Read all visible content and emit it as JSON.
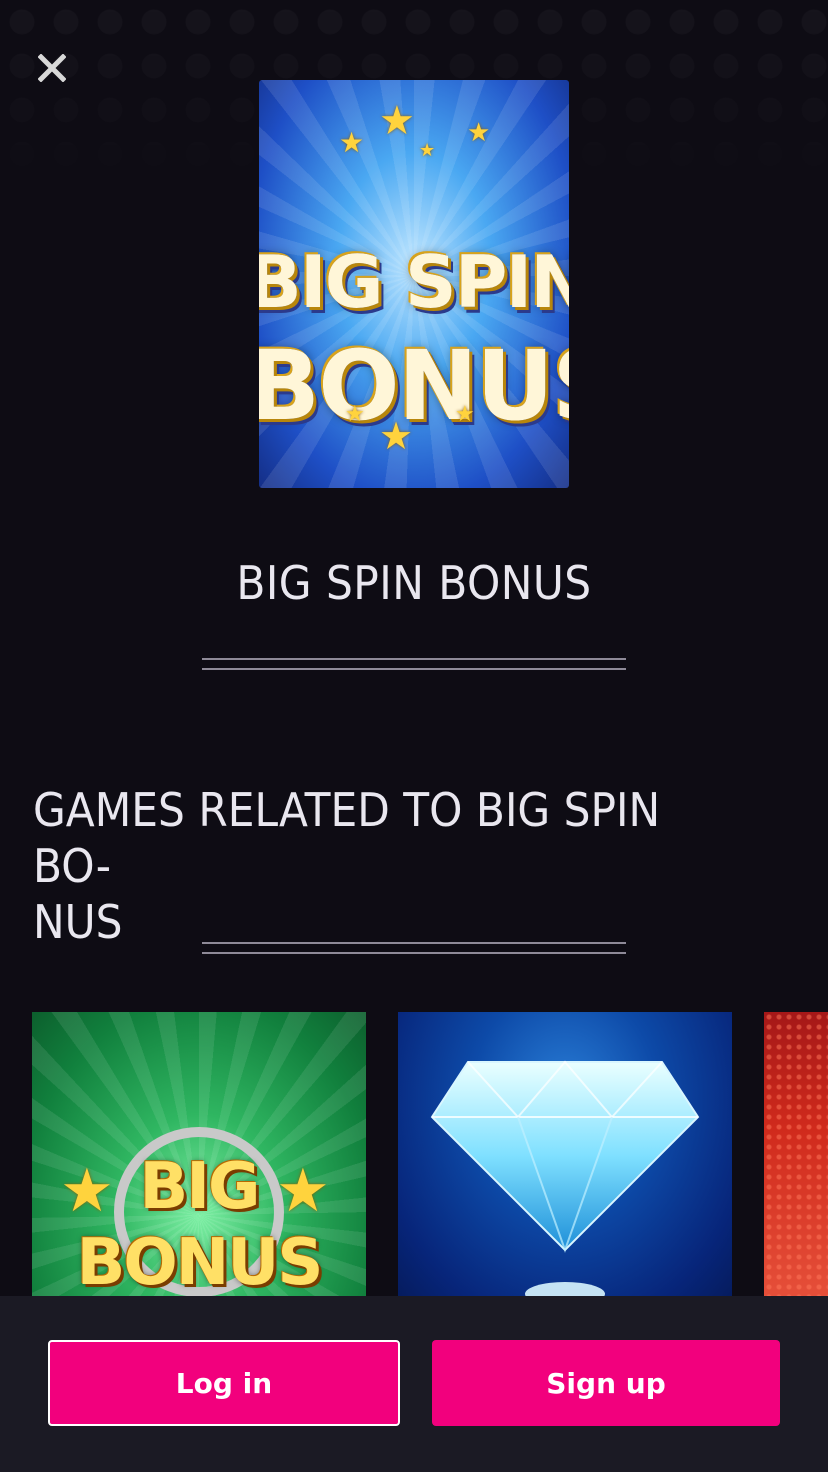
{
  "header": {
    "close_icon": "close-icon"
  },
  "hero": {
    "image_text_line1": "BIG SPIN",
    "image_text_line2": "BONUS"
  },
  "game": {
    "title": "BIG SPIN BONUS"
  },
  "related": {
    "title": "GAMES RELATED TO BIG SPIN BO-NUS",
    "title_line1": "GAMES RELATED TO BIG SPIN BO-",
    "title_line2": "NUS",
    "tiles": [
      {
        "image_text_line1": "BIG",
        "image_text_line2": "BONUS"
      },
      {
        "icon": "diamond-icon"
      },
      {
        "icon": "partial-tile"
      }
    ]
  },
  "auth": {
    "login_label": "Log in",
    "signup_label": "Sign up"
  },
  "colors": {
    "background": "#0e0c14",
    "accent": "#f2007d",
    "bottom_bar": "#1b1a24"
  }
}
